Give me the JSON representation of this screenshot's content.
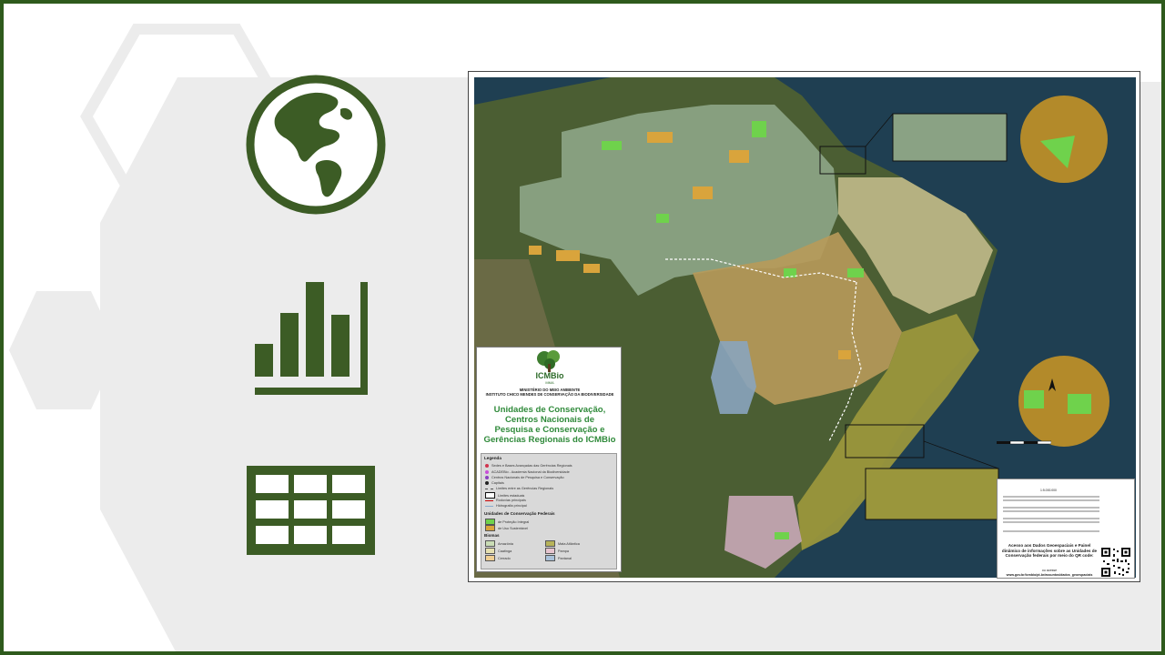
{
  "legend": {
    "brand": "ICMBio",
    "brand_sub": "MMA",
    "ministry": "MINISTÉRIO DO MEIO AMBIENTE",
    "institute": "INSTITUTO CHICO MENDES DE CONSERVAÇÃO DA BIODIVERSIDADE",
    "title": "Unidades de Conservação,\nCentros Nacionais de\nPesquisa e Conservação e\nGerências Regionais do ICMBio",
    "heading": "Legenda",
    "items": [
      "Sedes e Bases Avançadas das Gerências Regionais",
      "ACADEBio - Academia Nacional da Biodiversidade",
      "Centros Nacionais de Pesquisa e Conservação",
      "Capitais",
      "Limites entre as Gerências Regionais",
      "Limites estaduais",
      "Rodovias principais",
      "Hidrografia principal"
    ],
    "uc_heading": "Unidades de Conservação Federais",
    "uc_items": [
      "de Proteção Integral",
      "de Uso Sustentável"
    ],
    "biome_heading": "Biomas",
    "biomes": [
      {
        "name": "Amazônia",
        "color": "#c9dcb5"
      },
      {
        "name": "Caatinga",
        "color": "#e6e0b0"
      },
      {
        "name": "Cerrado",
        "color": "#f0cf93"
      },
      {
        "name": "Mata Atlântica",
        "color": "#b7b35a"
      },
      {
        "name": "Pampa",
        "color": "#e6c5cf"
      },
      {
        "name": "Pantanal",
        "color": "#a9c1d9"
      }
    ]
  },
  "info": {
    "scale": "1:5.000.000",
    "access_text": "Acesso aos Dados Geoespaciais e Painel dinâmico de informações sobre as Unidades de Conservação federais por meio do QR code:",
    "access_sub": "ou acesse",
    "access_link": "www.gov.br/icmbio/pt-br/assuntos/dados_geoespaciais"
  },
  "colors": {
    "frame": "#2e5a1c",
    "icon_green": "#3c5c25",
    "hex_gray": "#ebebeb",
    "protecao_integral": "#6fd24c",
    "uso_sustentavel": "#d9a43c"
  },
  "icons": [
    "globe-icon",
    "bar-chart-icon",
    "table-grid-icon"
  ]
}
